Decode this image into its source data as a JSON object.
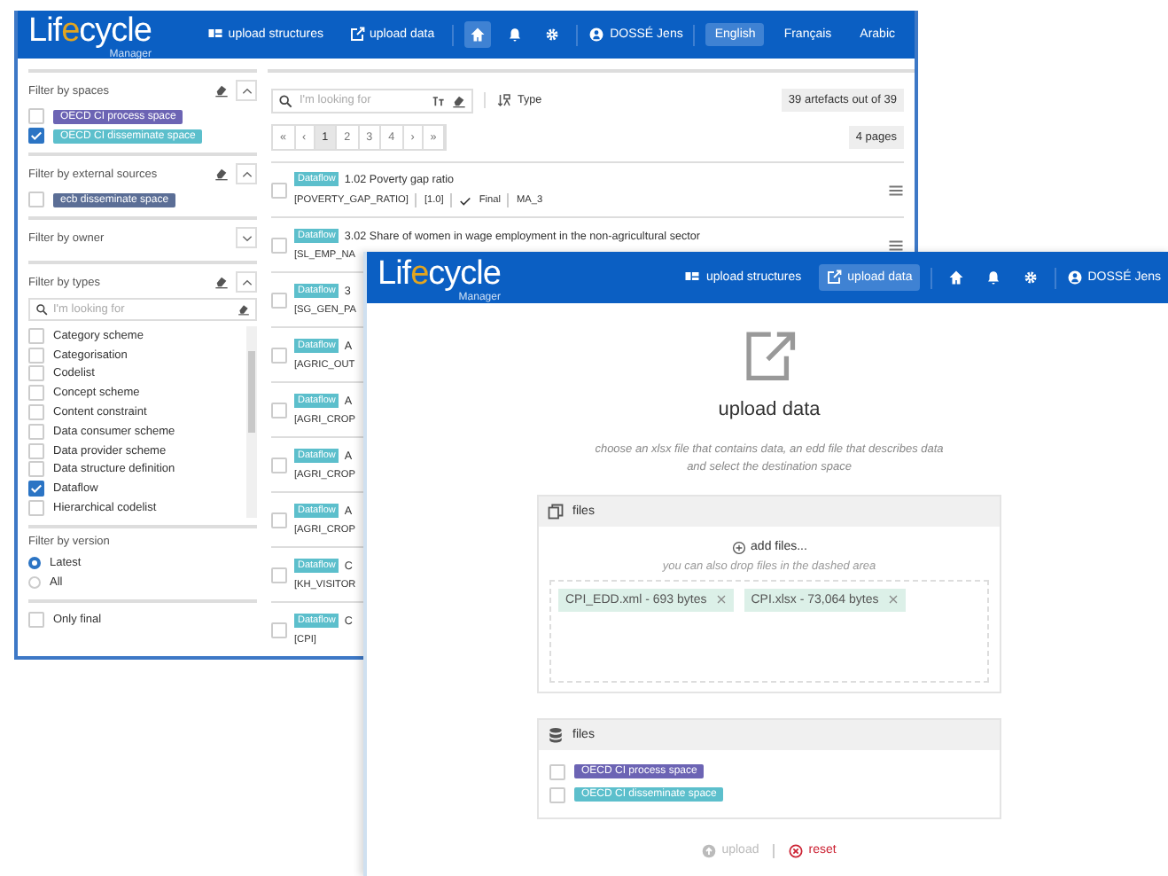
{
  "back_window": {
    "header": {
      "logo": {
        "before": "Lif",
        "accent": "e",
        "after": "cycle",
        "sub": "Manager"
      },
      "nav": [
        {
          "label": "upload structures",
          "selected": false
        },
        {
          "label": "upload data",
          "selected": false
        }
      ],
      "icons": [
        {
          "kind": "home",
          "selected": true
        },
        {
          "kind": "bell",
          "selected": false
        },
        {
          "kind": "gear",
          "selected": false
        }
      ],
      "user": "DOSSÉ Jens",
      "languages": [
        {
          "label": "English",
          "selected": true
        },
        {
          "label": "Français",
          "selected": false
        },
        {
          "label": "Arabic",
          "selected": false
        }
      ]
    },
    "filters": [
      {
        "kind": "spaces",
        "title": "Filter by spaces",
        "expanded": true,
        "items": [
          {
            "label": "OECD CI process space",
            "color": "#6c64b4",
            "checked": false
          },
          {
            "label": "OECD CI disseminate space",
            "color": "#5cbfcc",
            "checked": true
          }
        ]
      },
      {
        "kind": "spaces",
        "title": "Filter by external sources",
        "expanded": true,
        "items": [
          {
            "label": "ecb disseminate space",
            "color": "#5b6e96",
            "checked": false
          }
        ]
      },
      {
        "kind": "spaces",
        "title": "Filter by owner",
        "expanded": false
      },
      {
        "kind": "types",
        "title": "Filter by types",
        "expanded": true,
        "placeholder": "I'm looking for",
        "items": [
          {
            "label": "Category scheme",
            "checked": false
          },
          {
            "label": "Categorisation",
            "checked": false
          },
          {
            "label": "Codelist",
            "checked": false
          },
          {
            "label": "Concept scheme",
            "checked": false
          },
          {
            "label": "Content constraint",
            "checked": false
          },
          {
            "label": "Data consumer scheme",
            "checked": false
          },
          {
            "label": "Data provider scheme",
            "checked": false
          },
          {
            "label": "Data structure definition",
            "checked": false
          },
          {
            "label": "Dataflow",
            "checked": true
          },
          {
            "label": "Hierarchical codelist",
            "checked": false
          }
        ]
      },
      {
        "kind": "radio",
        "title": "Filter by version",
        "items": [
          {
            "label": "Latest",
            "selected": true
          },
          {
            "label": "All",
            "selected": false
          }
        ]
      },
      {
        "kind": "check",
        "items": [
          {
            "label": "Only final",
            "checked": false
          }
        ]
      }
    ],
    "main": {
      "search": {
        "placeholder": "I'm looking for"
      },
      "type_button": "Type",
      "count": "39 artefacts out of 39",
      "pager": {
        "first": "«",
        "prev": "‹",
        "pages": [
          {
            "label": "1",
            "selected": true
          },
          {
            "label": "2",
            "selected": false
          },
          {
            "label": "3",
            "selected": false
          },
          {
            "label": "4",
            "selected": false
          }
        ],
        "next": "›",
        "last": "»"
      },
      "pages_label": "4 pages",
      "rows": [
        {
          "tag": "Dataflow",
          "title": "1.02 Poverty gap ratio",
          "code": "[POVERTY_GAP_RATIO]",
          "version": "[1.0]",
          "status": "Final",
          "agency": "MA_3",
          "checked": false
        },
        {
          "tag": "Dataflow",
          "title": "3.02 Share of women in wage employment in the non-agricultural sector",
          "code": "[SL_EMP_NA",
          "checked": false
        },
        {
          "tag": "Dataflow",
          "title": "3",
          "code": "[SG_GEN_PA",
          "checked": false
        },
        {
          "tag": "Dataflow",
          "title": "A",
          "code": "[AGRIC_OUT",
          "checked": false
        },
        {
          "tag": "Dataflow",
          "title": "A",
          "code": "[AGRI_CROP",
          "checked": false
        },
        {
          "tag": "Dataflow",
          "title": "A",
          "code": "[AGRI_CROP",
          "checked": false
        },
        {
          "tag": "Dataflow",
          "title": "A",
          "code": "[AGRI_CROP",
          "checked": false
        },
        {
          "tag": "Dataflow",
          "title": "C",
          "code": "[KH_VISITOR",
          "checked": false
        },
        {
          "tag": "Dataflow",
          "title": "C",
          "code": "[CPI]",
          "checked": false
        }
      ]
    }
  },
  "front_window": {
    "header": {
      "logo": {
        "before": "Lif",
        "accent": "e",
        "after": "cycle",
        "sub": "Manager"
      },
      "nav": [
        {
          "label": "upload structures",
          "selected": false
        },
        {
          "label": "upload data",
          "selected": true
        }
      ],
      "icons": [
        {
          "kind": "home",
          "selected": false
        },
        {
          "kind": "bell",
          "selected": false
        },
        {
          "kind": "gear",
          "selected": false
        }
      ],
      "user": "DOSSÉ Jens"
    },
    "title": "upload data",
    "description": "choose an xlsx file that contains data, an edd file that describes data and select the destination space",
    "files_panel": {
      "title": "files",
      "add": "add files...",
      "hint": "you can also drop files in the dashed area",
      "files": [
        {
          "name": "CPI_EDD.xml - 693 bytes"
        },
        {
          "name": "CPI.xlsx - 73,064 bytes"
        }
      ]
    },
    "spaces_panel": {
      "title": "files",
      "items": [
        {
          "label": "OECD CI process space",
          "color": "#6c64b4",
          "checked": false
        },
        {
          "label": "OECD CI disseminate space",
          "color": "#5cbfcc",
          "checked": false
        }
      ]
    },
    "actions": [
      {
        "kind": "upload",
        "label": "upload",
        "disabled": true
      },
      {
        "kind": "reset",
        "label": "reset",
        "disabled": false
      }
    ]
  }
}
